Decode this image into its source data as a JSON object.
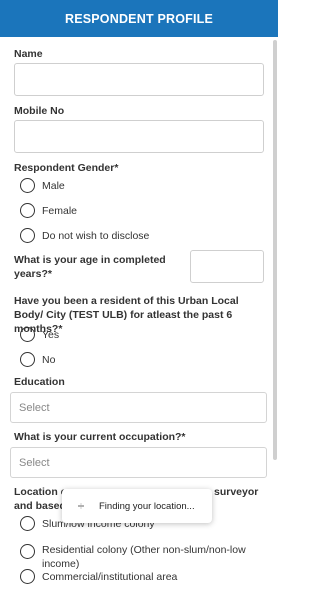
{
  "header": {
    "title": "RESPONDENT PROFILE"
  },
  "form": {
    "name_label": "Name",
    "mobile_label": "Mobile No",
    "gender_label": "Respondent Gender*",
    "gender_options": [
      "Male",
      "Female",
      "Do not wish to disclose"
    ],
    "age_label": "What is your age in completed years?*",
    "resident_label": "Have you been a resident of this Urban Local Body/ City (TEST ULB) for atleast the past 6 months?*",
    "resident_options": [
      "Yes",
      "No"
    ],
    "education_label": "Education",
    "education_placeholder": "Select",
    "occupation_label": "What is your current occupation?*",
    "occupation_placeholder": "Select",
    "location_label_part1": "Location o",
    "location_label_part2": "surveyor",
    "location_label_line2": "and based",
    "location_options": [
      "Slum/low income colony",
      "Residential colony (Other non-slum/non-low income)",
      "Commercial/institutional area"
    ]
  },
  "toast": {
    "text": "Finding your location...",
    "icon": "spinner-icon"
  },
  "colors": {
    "header_bg": "#1b75bb",
    "header_text": "#ffffff"
  }
}
